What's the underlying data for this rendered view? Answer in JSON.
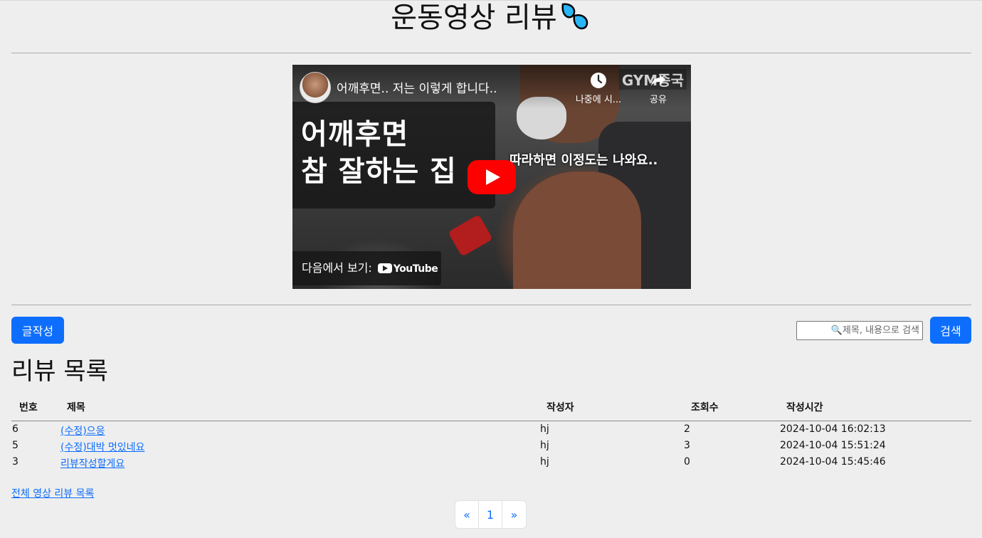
{
  "header": {
    "title": "운동영상 리뷰",
    "icon": "sweat-droplets-icon"
  },
  "video": {
    "title": "어깨후면.. 저는 이렇게 합니다..",
    "thumbnail_headline_line1": "어깨후면",
    "thumbnail_headline_line2": "참 잘하는 집",
    "thumbnail_caption": "따라하면 이정도는 나와요..",
    "watermark": "GYM종국",
    "watch_later_label": "나중에 시...",
    "share_label": "공유",
    "watch_on_label": "다음에서 보기:",
    "youtube_label": "YouTube"
  },
  "controls": {
    "write_button": "글작성",
    "search_placeholder": "🔍제목, 내용으로 검색",
    "search_button": "검색"
  },
  "list": {
    "title": "리뷰 목록",
    "columns": [
      "번호",
      "제목",
      "작성자",
      "조회수",
      "작성시간"
    ],
    "rows": [
      {
        "no": "6",
        "title": "(수정)으응",
        "writer": "hj",
        "views": "2",
        "time": "2024-10-04 16:02:13"
      },
      {
        "no": "5",
        "title": "(수정)대박 멋있네요",
        "writer": "hj",
        "views": "3",
        "time": "2024-10-04 15:51:24"
      },
      {
        "no": "3",
        "title": "리뷰작성할게요",
        "writer": "hj",
        "views": "0",
        "time": "2024-10-04 15:45:46"
      }
    ],
    "all_reviews_link": "전체 영상 리뷰 목록"
  },
  "pagination": {
    "prev": "«",
    "pages": [
      "1"
    ],
    "next": "»"
  },
  "colors": {
    "primary": "#0d6efd",
    "background": "#eeeeee",
    "youtube_red": "#ff0000"
  }
}
